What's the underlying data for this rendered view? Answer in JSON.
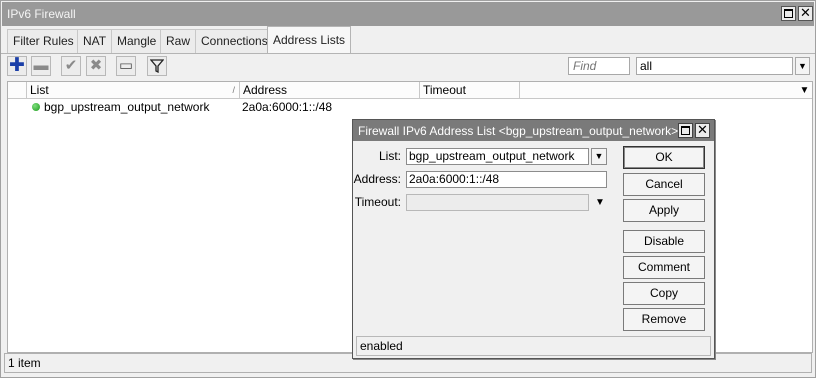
{
  "window": {
    "title": "IPv6 Firewall"
  },
  "tabs": [
    {
      "label": "Filter Rules"
    },
    {
      "label": "NAT"
    },
    {
      "label": "Mangle"
    },
    {
      "label": "Raw"
    },
    {
      "label": "Connections"
    },
    {
      "label": "Address Lists",
      "active": true
    }
  ],
  "toolbar": {
    "find_placeholder": "Find",
    "filter_value": "all",
    "icons": [
      "plus-icon",
      "minus-icon",
      "check-icon",
      "cross-icon",
      "comment-icon",
      "filter-icon"
    ]
  },
  "table": {
    "columns": [
      "List",
      "Address",
      "Timeout"
    ],
    "rows": [
      {
        "list": "bgp_upstream_output_network",
        "address": "2a0a:6000:1::/48",
        "timeout": "",
        "status_color": "#2aa52a"
      }
    ]
  },
  "status": {
    "items": "1 item"
  },
  "dialog": {
    "title": "Firewall IPv6 Address List <bgp_upstream_output_network>",
    "fields": {
      "list_label": "List:",
      "list_value": "bgp_upstream_output_network",
      "address_label": "Address:",
      "address_value": "2a0a:6000:1::/48",
      "timeout_label": "Timeout:",
      "timeout_value": ""
    },
    "buttons": {
      "ok": "OK",
      "cancel": "Cancel",
      "apply": "Apply",
      "disable": "Disable",
      "comment": "Comment",
      "copy": "Copy",
      "remove": "Remove"
    },
    "status": "enabled"
  },
  "colors": {
    "titlebar": "#999999",
    "dialog_titlebar": "#7a7a7a",
    "add_icon": "#1b3fa8",
    "enabled_dot": "#2aa52a"
  }
}
